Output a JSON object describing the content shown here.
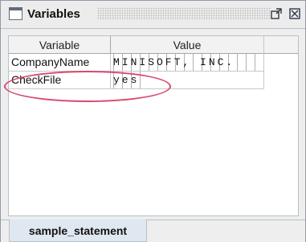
{
  "window": {
    "title": "Variables",
    "icon": "window-icon",
    "buttons": {
      "float_icon": "float-icon",
      "close_icon": "close-icon"
    }
  },
  "table": {
    "columns": [
      "Variable",
      "Value"
    ],
    "rows": [
      {
        "variable": "CompanyName",
        "value": "MINISOFT, INC."
      },
      {
        "variable": "CheckFile",
        "value": "yes"
      }
    ]
  },
  "annotation": {
    "shape": "ellipse",
    "color": "#d64a6e",
    "target": "CheckFile row"
  },
  "tabs": [
    {
      "label": "sample_statement",
      "selected": true
    }
  ]
}
